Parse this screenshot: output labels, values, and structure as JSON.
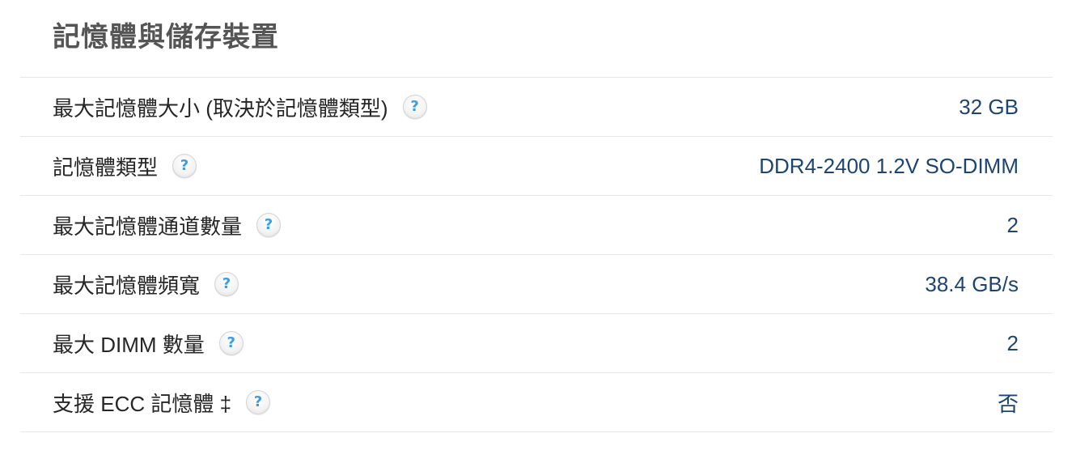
{
  "section": {
    "title": "記憶體與儲存裝置"
  },
  "rows": [
    {
      "label": "最大記憶體大小 (取決於記憶體類型)",
      "value": "32 GB"
    },
    {
      "label": "記憶體類型",
      "value": "DDR4-2400 1.2V SO-DIMM"
    },
    {
      "label": "最大記憶體通道數量",
      "value": "2"
    },
    {
      "label": "最大記憶體頻寬",
      "value": "38.4 GB/s"
    },
    {
      "label": "最大 DIMM 數量",
      "value": "2"
    },
    {
      "label": "支援 ECC 記憶體 ‡",
      "value": "否"
    }
  ],
  "icons": {
    "help_glyph": "?"
  },
  "colors": {
    "title": "#555555",
    "label": "#262626",
    "value": "#1c4574",
    "help_icon": "#3a9de6",
    "divider": "#e6e6e6"
  }
}
